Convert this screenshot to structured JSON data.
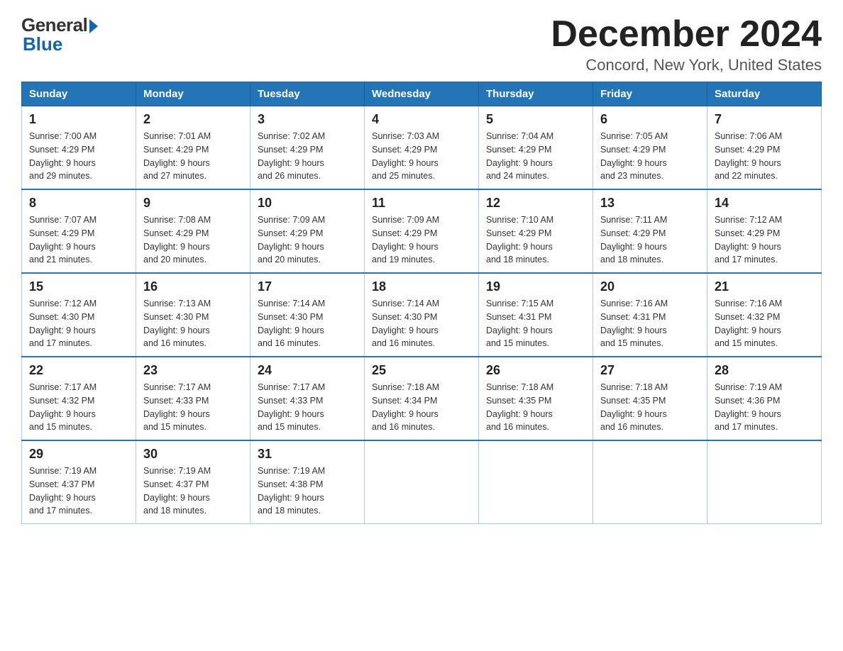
{
  "logo": {
    "general": "General",
    "blue": "Blue"
  },
  "title": "December 2024",
  "location": "Concord, New York, United States",
  "days_of_week": [
    "Sunday",
    "Monday",
    "Tuesday",
    "Wednesday",
    "Thursday",
    "Friday",
    "Saturday"
  ],
  "weeks": [
    [
      {
        "day": "1",
        "sunrise": "7:00 AM",
        "sunset": "4:29 PM",
        "daylight": "9 hours and 29 minutes."
      },
      {
        "day": "2",
        "sunrise": "7:01 AM",
        "sunset": "4:29 PM",
        "daylight": "9 hours and 27 minutes."
      },
      {
        "day": "3",
        "sunrise": "7:02 AM",
        "sunset": "4:29 PM",
        "daylight": "9 hours and 26 minutes."
      },
      {
        "day": "4",
        "sunrise": "7:03 AM",
        "sunset": "4:29 PM",
        "daylight": "9 hours and 25 minutes."
      },
      {
        "day": "5",
        "sunrise": "7:04 AM",
        "sunset": "4:29 PM",
        "daylight": "9 hours and 24 minutes."
      },
      {
        "day": "6",
        "sunrise": "7:05 AM",
        "sunset": "4:29 PM",
        "daylight": "9 hours and 23 minutes."
      },
      {
        "day": "7",
        "sunrise": "7:06 AM",
        "sunset": "4:29 PM",
        "daylight": "9 hours and 22 minutes."
      }
    ],
    [
      {
        "day": "8",
        "sunrise": "7:07 AM",
        "sunset": "4:29 PM",
        "daylight": "9 hours and 21 minutes."
      },
      {
        "day": "9",
        "sunrise": "7:08 AM",
        "sunset": "4:29 PM",
        "daylight": "9 hours and 20 minutes."
      },
      {
        "day": "10",
        "sunrise": "7:09 AM",
        "sunset": "4:29 PM",
        "daylight": "9 hours and 20 minutes."
      },
      {
        "day": "11",
        "sunrise": "7:09 AM",
        "sunset": "4:29 PM",
        "daylight": "9 hours and 19 minutes."
      },
      {
        "day": "12",
        "sunrise": "7:10 AM",
        "sunset": "4:29 PM",
        "daylight": "9 hours and 18 minutes."
      },
      {
        "day": "13",
        "sunrise": "7:11 AM",
        "sunset": "4:29 PM",
        "daylight": "9 hours and 18 minutes."
      },
      {
        "day": "14",
        "sunrise": "7:12 AM",
        "sunset": "4:29 PM",
        "daylight": "9 hours and 17 minutes."
      }
    ],
    [
      {
        "day": "15",
        "sunrise": "7:12 AM",
        "sunset": "4:30 PM",
        "daylight": "9 hours and 17 minutes."
      },
      {
        "day": "16",
        "sunrise": "7:13 AM",
        "sunset": "4:30 PM",
        "daylight": "9 hours and 16 minutes."
      },
      {
        "day": "17",
        "sunrise": "7:14 AM",
        "sunset": "4:30 PM",
        "daylight": "9 hours and 16 minutes."
      },
      {
        "day": "18",
        "sunrise": "7:14 AM",
        "sunset": "4:30 PM",
        "daylight": "9 hours and 16 minutes."
      },
      {
        "day": "19",
        "sunrise": "7:15 AM",
        "sunset": "4:31 PM",
        "daylight": "9 hours and 15 minutes."
      },
      {
        "day": "20",
        "sunrise": "7:16 AM",
        "sunset": "4:31 PM",
        "daylight": "9 hours and 15 minutes."
      },
      {
        "day": "21",
        "sunrise": "7:16 AM",
        "sunset": "4:32 PM",
        "daylight": "9 hours and 15 minutes."
      }
    ],
    [
      {
        "day": "22",
        "sunrise": "7:17 AM",
        "sunset": "4:32 PM",
        "daylight": "9 hours and 15 minutes."
      },
      {
        "day": "23",
        "sunrise": "7:17 AM",
        "sunset": "4:33 PM",
        "daylight": "9 hours and 15 minutes."
      },
      {
        "day": "24",
        "sunrise": "7:17 AM",
        "sunset": "4:33 PM",
        "daylight": "9 hours and 15 minutes."
      },
      {
        "day": "25",
        "sunrise": "7:18 AM",
        "sunset": "4:34 PM",
        "daylight": "9 hours and 16 minutes."
      },
      {
        "day": "26",
        "sunrise": "7:18 AM",
        "sunset": "4:35 PM",
        "daylight": "9 hours and 16 minutes."
      },
      {
        "day": "27",
        "sunrise": "7:18 AM",
        "sunset": "4:35 PM",
        "daylight": "9 hours and 16 minutes."
      },
      {
        "day": "28",
        "sunrise": "7:19 AM",
        "sunset": "4:36 PM",
        "daylight": "9 hours and 17 minutes."
      }
    ],
    [
      {
        "day": "29",
        "sunrise": "7:19 AM",
        "sunset": "4:37 PM",
        "daylight": "9 hours and 17 minutes."
      },
      {
        "day": "30",
        "sunrise": "7:19 AM",
        "sunset": "4:37 PM",
        "daylight": "9 hours and 18 minutes."
      },
      {
        "day": "31",
        "sunrise": "7:19 AM",
        "sunset": "4:38 PM",
        "daylight": "9 hours and 18 minutes."
      },
      null,
      null,
      null,
      null
    ]
  ]
}
